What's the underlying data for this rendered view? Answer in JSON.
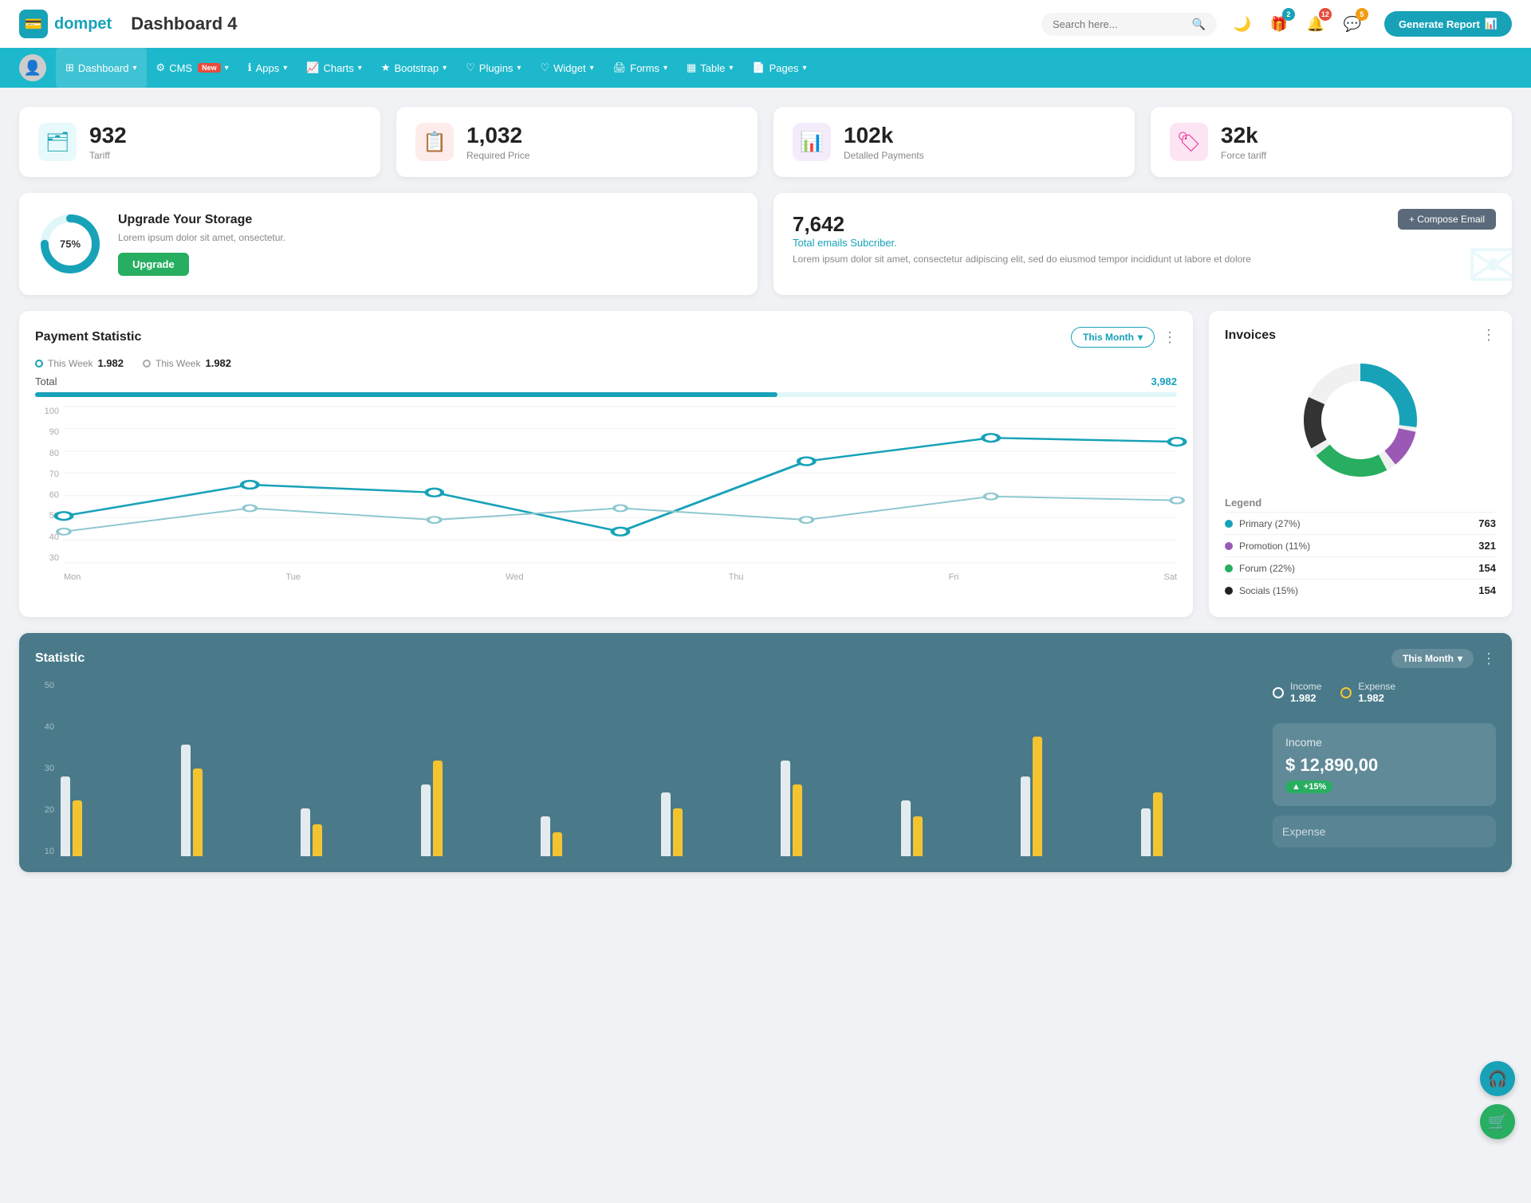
{
  "header": {
    "logo_icon": "💳",
    "logo_text": "dompet",
    "page_title": "Dashboard 4",
    "search_placeholder": "Search here...",
    "icons": [
      {
        "name": "moon-icon",
        "symbol": "🌙",
        "badge": null
      },
      {
        "name": "gift-icon",
        "symbol": "🎁",
        "badge": {
          "count": "2",
          "color": "teal"
        }
      },
      {
        "name": "bell-icon",
        "symbol": "🔔",
        "badge": {
          "count": "12",
          "color": "red"
        }
      },
      {
        "name": "chat-icon",
        "symbol": "💬",
        "badge": {
          "count": "5",
          "color": "yellow"
        }
      }
    ],
    "generate_btn": "Generate Report"
  },
  "navbar": {
    "items": [
      {
        "label": "Dashboard",
        "icon": "⊞",
        "active": true,
        "badge": null
      },
      {
        "label": "CMS",
        "icon": "⚙",
        "active": false,
        "badge": "New"
      },
      {
        "label": "Apps",
        "icon": "ℹ",
        "active": false,
        "badge": null
      },
      {
        "label": "Charts",
        "icon": "📈",
        "active": false,
        "badge": null
      },
      {
        "label": "Bootstrap",
        "icon": "★",
        "active": false,
        "badge": null
      },
      {
        "label": "Plugins",
        "icon": "♡",
        "active": false,
        "badge": null
      },
      {
        "label": "Widget",
        "icon": "♡",
        "active": false,
        "badge": null
      },
      {
        "label": "Forms",
        "icon": "🖨",
        "active": false,
        "badge": null
      },
      {
        "label": "Table",
        "icon": "▦",
        "active": false,
        "badge": null
      },
      {
        "label": "Pages",
        "icon": "📄",
        "active": false,
        "badge": null
      }
    ]
  },
  "stat_cards": [
    {
      "icon": "🗂",
      "icon_class": "teal",
      "value": "932",
      "label": "Tariff"
    },
    {
      "icon": "📋",
      "icon_class": "red",
      "value": "1,032",
      "label": "Required Price"
    },
    {
      "icon": "📊",
      "icon_class": "purple",
      "value": "102k",
      "label": "Detalled Payments"
    },
    {
      "icon": "🏷",
      "icon_class": "pink",
      "value": "32k",
      "label": "Force tariff"
    }
  ],
  "storage": {
    "percent": "75%",
    "title": "Upgrade Your Storage",
    "desc": "Lorem ipsum dolor sit amet, onsectetur.",
    "btn_label": "Upgrade"
  },
  "email": {
    "compose_btn": "+ Compose Email",
    "number": "7,642",
    "subtitle": "Total emails Subcriber.",
    "desc": "Lorem ipsum dolor sit amet, consectetur adipiscing elit, sed do eiusmod tempor incididunt ut labore et dolore"
  },
  "payment_chart": {
    "title": "Payment Statistic",
    "period_btn": "This Month",
    "more_icon": "⋮",
    "legend": [
      {
        "label": "This Week",
        "value": "1.982",
        "color": "#17a2b8"
      },
      {
        "label": "This Week",
        "value": "1.982",
        "color": "#aaa"
      }
    ],
    "total_label": "Total",
    "total_value": "3,982",
    "x_labels": [
      "Mon",
      "Tue",
      "Wed",
      "Thu",
      "Fri",
      "Sat"
    ],
    "y_labels": [
      "100",
      "90",
      "80",
      "70",
      "60",
      "50",
      "40",
      "30"
    ],
    "line1_points": "0,50 100,35 200,60 300,30 400,45 500,20 600,20",
    "line2_points": "0,70 100,60 200,55 300,70 400,55 500,45 600,50"
  },
  "invoices": {
    "title": "Invoices",
    "more_icon": "⋮",
    "legend_title": "Legend",
    "items": [
      {
        "label": "Primary (27%)",
        "color": "#17a2b8",
        "value": "763"
      },
      {
        "label": "Promotion (11%)",
        "color": "#9b59b6",
        "value": "321"
      },
      {
        "label": "Forum (22%)",
        "color": "#27ae60",
        "value": "154"
      },
      {
        "label": "Socials (15%)",
        "color": "#222",
        "value": "154"
      }
    ]
  },
  "statistic": {
    "title": "Statistic",
    "period_btn": "This Month",
    "more_icon": "⋮",
    "y_labels": [
      "50",
      "40",
      "30",
      "20",
      "10"
    ],
    "legend": [
      {
        "label": "Income",
        "value": "1.982",
        "color": "#fff"
      },
      {
        "label": "Expense",
        "value": "1.982",
        "color": "#f4c430"
      }
    ],
    "income_panel": {
      "title": "Income",
      "value": "$ 12,890,00",
      "badge": "+15%"
    },
    "expense_label": "Expense"
  }
}
